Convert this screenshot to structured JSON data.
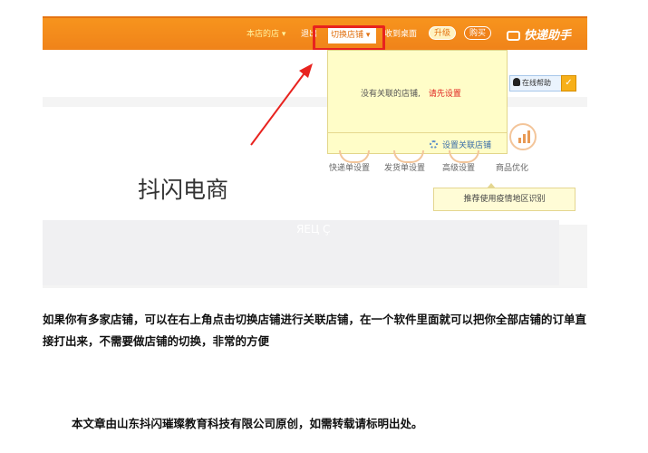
{
  "topbar": {
    "my_shop": "本店的店",
    "dropdown": "▾",
    "logout": "退出",
    "switch_shop": "切换店铺",
    "send_to_desktop": "收到桌面",
    "upgrade": "升级",
    "buy": "购买",
    "brand": "快递助手"
  },
  "popup": {
    "no_shop_msg": "没有关联的店铺,",
    "setup_first": "请先设置",
    "setup_link": "设置关联店铺"
  },
  "online_help": "在线帮助",
  "features": [
    "快递单设置",
    "发货单设置",
    "高级设置",
    "商品优化"
  ],
  "tooltip": "推荐使用疫情地区识别",
  "page_title": "抖闪电商",
  "faded_text": "ЯЕЦ Ç",
  "article": {
    "paragraph": "如果你有多家店铺，可以在右上角点击切换店铺进行关联店铺，在一个软件里面就可以把你全部店铺的订单直接打出来，不需要做店铺的切换，非常的方便",
    "footer": "本文章由山东抖闪璀璨教育科技有限公司原创，如需转载请标明出处。"
  },
  "colors": {
    "topbar_orange": "#f7941d",
    "highlight_red": "#e8231f",
    "popup_yellow": "#fffdc8"
  }
}
